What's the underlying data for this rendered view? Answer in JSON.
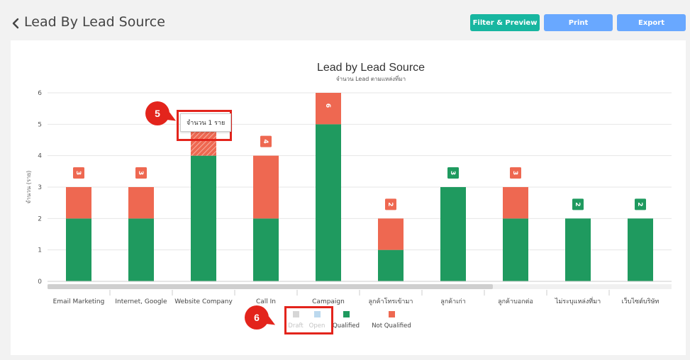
{
  "header": {
    "title": "Lead By Lead Source",
    "filter_label": "Filter & Preview",
    "print_label": "Print",
    "export_label": "Export"
  },
  "colors": {
    "qualified": "#1f9a5f",
    "not_qualified": "#ee6851",
    "draft": "#d6d6d6",
    "open": "#bcd9ee",
    "teal_button": "#17b6a0",
    "blue_button": "#69a8ff",
    "annotation": "#e3241c"
  },
  "tooltip": {
    "text": "จำนวน 1 ราย"
  },
  "annotations": [
    "5",
    "6"
  ],
  "chart_data": {
    "type": "bar",
    "stacked": true,
    "title": "Lead by Lead Source",
    "subtitle": "จำนวน Lead ตามแหล่งที่มา",
    "ylabel": "จำนวน (ราย)",
    "ylim": [
      0,
      6
    ],
    "yticks": [
      0,
      1,
      2,
      3,
      4,
      5,
      6
    ],
    "grid": true,
    "legend_position": "bottom",
    "categories": [
      "Email Marketing",
      "Internet, Google",
      "Website Company",
      "Call In",
      "Campaign",
      "ลูกค้าโทรเข้ามา",
      "ลูกค้าเก่า",
      "ลูกค้าบอกต่อ",
      "ไม่ระบุแหล่งที่มา",
      "เว็บไซต์บริษัท"
    ],
    "totals": [
      "3",
      "3",
      "",
      "4",
      "6",
      "2",
      "3",
      "3",
      "2",
      "2"
    ],
    "series": [
      {
        "name": "Draft",
        "values": [
          0,
          0,
          0,
          0,
          0,
          0,
          0,
          0,
          0,
          0
        ],
        "hidden": true
      },
      {
        "name": "Open",
        "values": [
          0,
          0,
          0,
          0,
          0,
          0,
          0,
          0,
          0,
          0
        ],
        "hidden": true
      },
      {
        "name": "Qualified",
        "values": [
          2,
          2,
          4,
          2,
          5,
          1,
          3,
          2,
          2,
          2
        ]
      },
      {
        "name": "Not Qualified",
        "values": [
          1,
          1,
          1,
          2,
          1,
          1,
          0,
          1,
          0,
          0
        ]
      }
    ],
    "hovered": {
      "category": "Website Company",
      "series": "Not Qualified"
    }
  }
}
